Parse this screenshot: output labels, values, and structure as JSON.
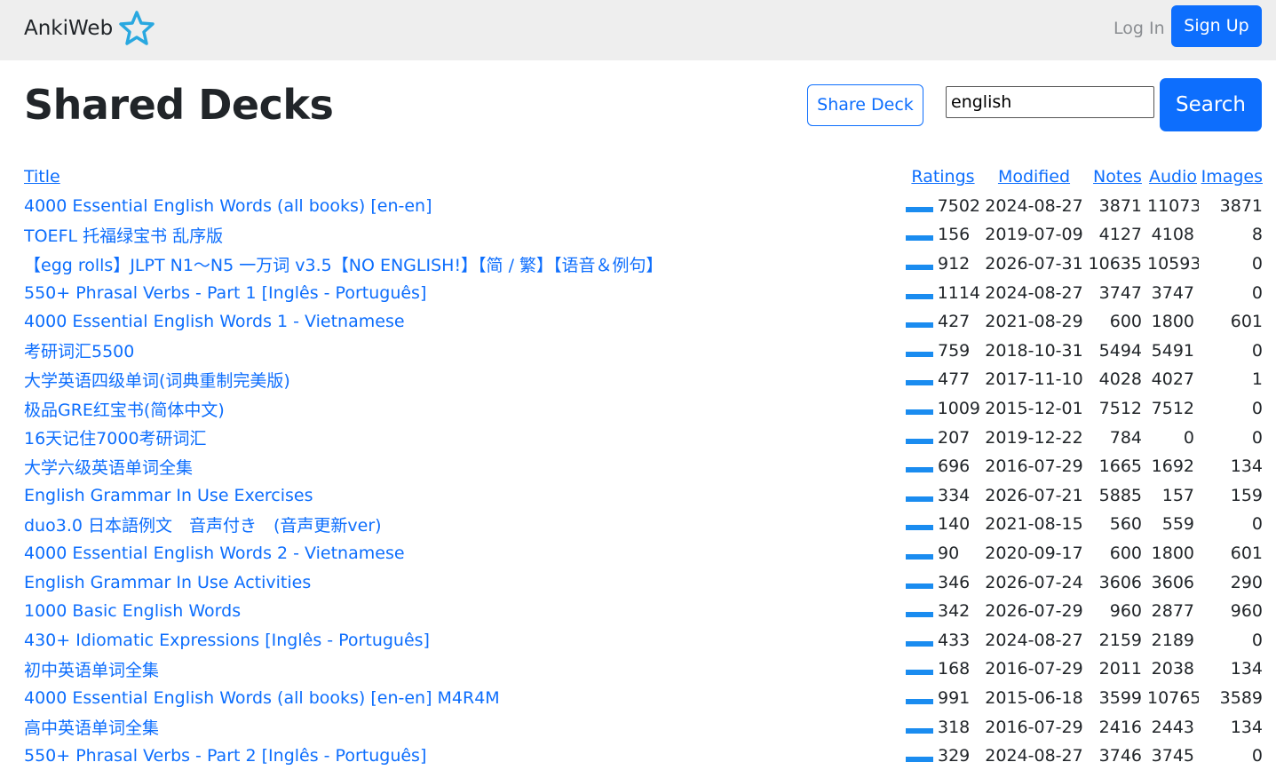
{
  "nav": {
    "brand": "AnkiWeb",
    "login": "Log In",
    "signup": "Sign Up"
  },
  "page": {
    "title": "Shared Decks",
    "share_deck": "Share Deck",
    "search_value": "english",
    "search_button": "Search"
  },
  "table": {
    "headers": {
      "title": "Title",
      "ratings": "Ratings",
      "modified": "Modified",
      "notes": "Notes",
      "audio": "Audio",
      "images": "Images"
    },
    "rows": [
      {
        "title": "4000 Essential English Words (all books) [en-en]",
        "ratings": "7502",
        "modified": "2024-08-27",
        "notes": "3871",
        "audio": "11073",
        "images": "3871"
      },
      {
        "title": "TOEFL 托福绿宝书 乱序版",
        "ratings": "156",
        "modified": "2019-07-09",
        "notes": "4127",
        "audio": "4108",
        "images": "8"
      },
      {
        "title": "【egg rolls】JLPT N1～N5 一万词 v3.5【NO ENGLISH!】【简 / 繁】【语音＆例句】",
        "ratings": "912",
        "modified": "2026-07-31",
        "notes": "10635",
        "audio": "10593",
        "images": "0"
      },
      {
        "title": "550+ Phrasal Verbs - Part 1 [Inglês - Português]",
        "ratings": "1114",
        "modified": "2024-08-27",
        "notes": "3747",
        "audio": "3747",
        "images": "0"
      },
      {
        "title": "4000 Essential English Words 1 - Vietnamese",
        "ratings": "427",
        "modified": "2021-08-29",
        "notes": "600",
        "audio": "1800",
        "images": "601"
      },
      {
        "title": "考研词汇5500",
        "ratings": "759",
        "modified": "2018-10-31",
        "notes": "5494",
        "audio": "5491",
        "images": "0"
      },
      {
        "title": "大学英语四级单词(词典重制完美版)",
        "ratings": "477",
        "modified": "2017-11-10",
        "notes": "4028",
        "audio": "4027",
        "images": "1"
      },
      {
        "title": "极品GRE红宝书(简体中文)",
        "ratings": "1009",
        "modified": "2015-12-01",
        "notes": "7512",
        "audio": "7512",
        "images": "0"
      },
      {
        "title": "16天记住7000考研词汇",
        "ratings": "207",
        "modified": "2019-12-22",
        "notes": "784",
        "audio": "0",
        "images": "0"
      },
      {
        "title": "大学六级英语单词全集",
        "ratings": "696",
        "modified": "2016-07-29",
        "notes": "1665",
        "audio": "1692",
        "images": "134"
      },
      {
        "title": "English Grammar In Use Exercises",
        "ratings": "334",
        "modified": "2026-07-21",
        "notes": "5885",
        "audio": "157",
        "images": "159"
      },
      {
        "title": "duo3.0 日本語例文　音声付き　(音声更新ver)",
        "ratings": "140",
        "modified": "2021-08-15",
        "notes": "560",
        "audio": "559",
        "images": "0"
      },
      {
        "title": "4000 Essential English Words 2 - Vietnamese",
        "ratings": "90",
        "modified": "2020-09-17",
        "notes": "600",
        "audio": "1800",
        "images": "601"
      },
      {
        "title": "English Grammar In Use Activities",
        "ratings": "346",
        "modified": "2026-07-24",
        "notes": "3606",
        "audio": "3606",
        "images": "290"
      },
      {
        "title": "1000 Basic English Words",
        "ratings": "342",
        "modified": "2026-07-29",
        "notes": "960",
        "audio": "2877",
        "images": "960"
      },
      {
        "title": "430+ Idiomatic Expressions [Inglês - Português]",
        "ratings": "433",
        "modified": "2024-08-27",
        "notes": "2159",
        "audio": "2189",
        "images": "0"
      },
      {
        "title": "初中英语单词全集",
        "ratings": "168",
        "modified": "2016-07-29",
        "notes": "2011",
        "audio": "2038",
        "images": "134"
      },
      {
        "title": "4000 Essential English Words (all books) [en-en] M4R4M",
        "ratings": "991",
        "modified": "2015-06-18",
        "notes": "3599",
        "audio": "10765",
        "images": "3589"
      },
      {
        "title": "高中英语单词全集",
        "ratings": "318",
        "modified": "2016-07-29",
        "notes": "2416",
        "audio": "2443",
        "images": "134"
      },
      {
        "title": "550+ Phrasal Verbs - Part 2 [Inglês - Português]",
        "ratings": "329",
        "modified": "2024-08-27",
        "notes": "3746",
        "audio": "3745",
        "images": "0"
      }
    ]
  },
  "colors": {
    "primary": "#0d6efd",
    "navbar_bg": "#eeeeee",
    "rating_bar": "#1a8cf0",
    "logo_star": "#29a8e0"
  },
  "icons": {
    "brand_logo": "star-icon",
    "rating_bar": "rating-bar-icon"
  }
}
